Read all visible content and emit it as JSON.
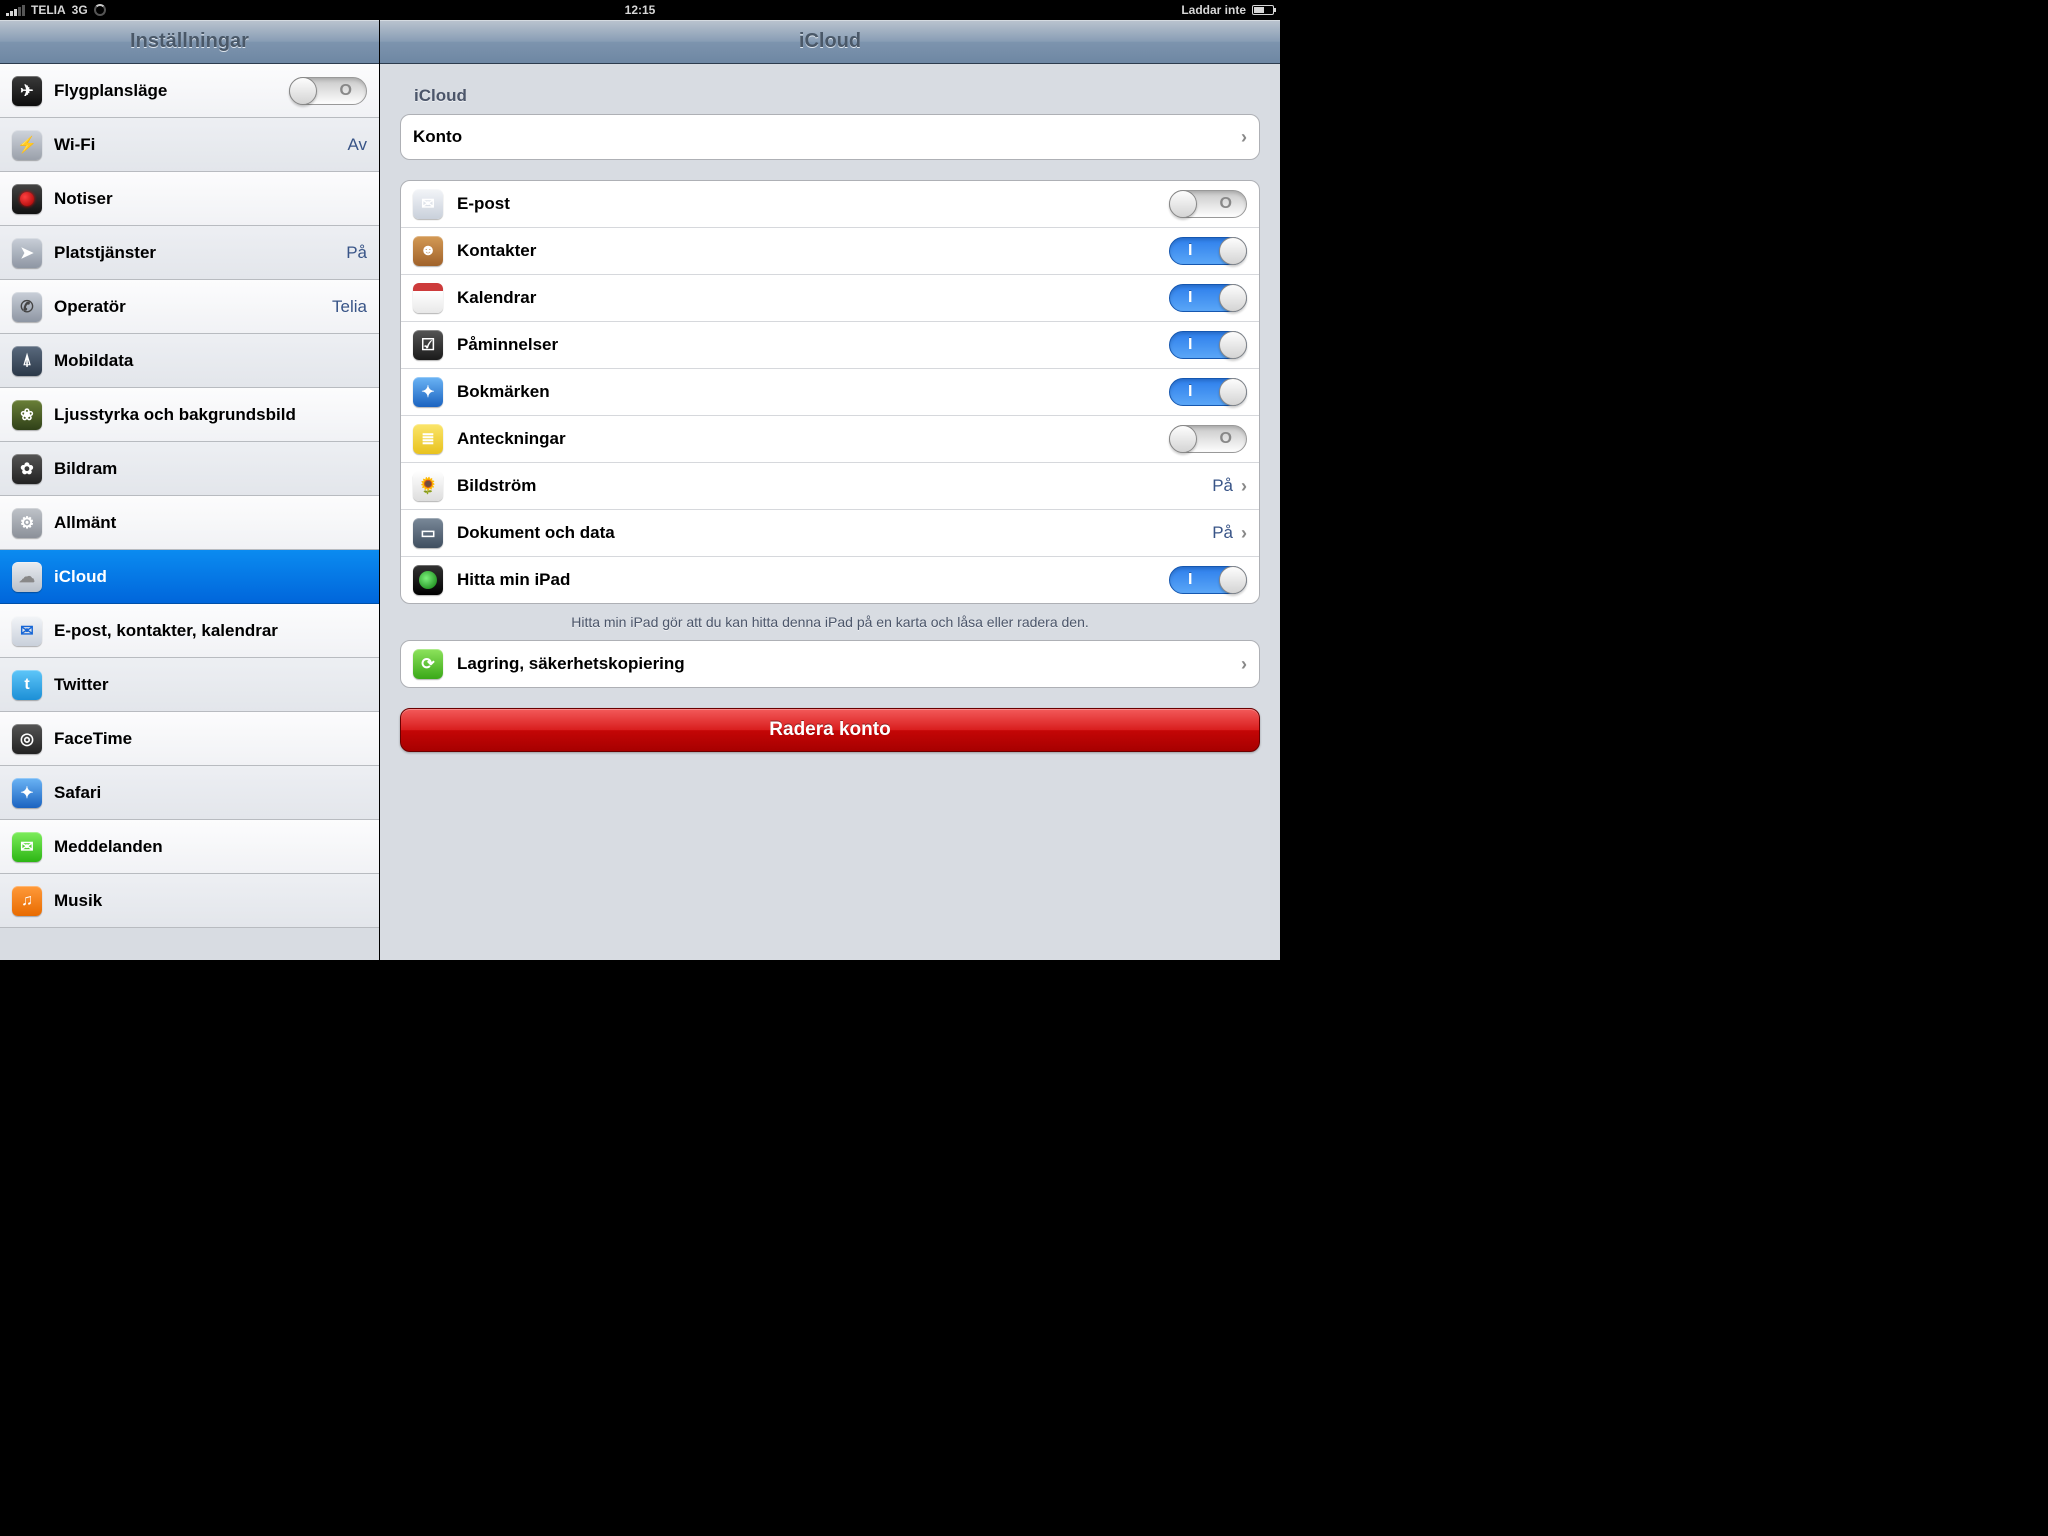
{
  "status": {
    "carrier": "TELIA",
    "network": "3G",
    "time": "12:15",
    "right": "Laddar inte"
  },
  "sidebar": {
    "title": "Inställningar",
    "items": [
      {
        "label": "Flygplansläge",
        "type": "toggle",
        "toggle": "off",
        "icon": "i-airplane",
        "glyph": "✈"
      },
      {
        "label": "Wi-Fi",
        "type": "value",
        "value": "Av",
        "icon": "i-wifi",
        "glyph": "⚡"
      },
      {
        "label": "Notiser",
        "type": "plain",
        "icon": "i-notif",
        "glyph": ""
      },
      {
        "label": "Platstjänster",
        "type": "value",
        "value": "På",
        "icon": "i-loc",
        "glyph": "➤"
      },
      {
        "label": "Operatör",
        "type": "value",
        "value": "Telia",
        "icon": "i-op",
        "glyph": "✆"
      },
      {
        "label": "Mobildata",
        "type": "plain",
        "icon": "i-cell",
        "glyph": "⍋"
      },
      {
        "label": "Ljusstyrka och bakgrundsbild",
        "type": "plain",
        "icon": "i-bright",
        "glyph": "❀"
      },
      {
        "label": "Bildram",
        "type": "plain",
        "icon": "i-frame",
        "glyph": "✿"
      },
      {
        "label": "Allmänt",
        "type": "plain",
        "icon": "i-general",
        "glyph": "⚙"
      },
      {
        "label": "iCloud",
        "type": "plain",
        "icon": "i-icloud",
        "glyph": "☁",
        "selected": true
      },
      {
        "label": "E-post, kontakter, kalendrar",
        "type": "plain",
        "icon": "i-mail",
        "glyph": "✉"
      },
      {
        "label": "Twitter",
        "type": "plain",
        "icon": "i-twitter",
        "glyph": "t"
      },
      {
        "label": "FaceTime",
        "type": "plain",
        "icon": "i-facetime",
        "glyph": "◎"
      },
      {
        "label": "Safari",
        "type": "plain",
        "icon": "i-safari",
        "glyph": "✦"
      },
      {
        "label": "Meddelanden",
        "type": "plain",
        "icon": "i-msg",
        "glyph": "✉"
      },
      {
        "label": "Musik",
        "type": "plain",
        "icon": "i-music",
        "glyph": "♫"
      }
    ]
  },
  "detail": {
    "title": "iCloud",
    "section_header": "iCloud",
    "account_row": {
      "label": "Konto",
      "value": ""
    },
    "services": [
      {
        "label": "E-post",
        "icon": "i-mail",
        "glyph": "✉",
        "type": "toggle",
        "toggle": "off"
      },
      {
        "label": "Kontakter",
        "icon": "i-contacts",
        "glyph": "☻",
        "type": "toggle",
        "toggle": "on"
      },
      {
        "label": "Kalendrar",
        "icon": "i-cal",
        "glyph": "",
        "type": "toggle",
        "toggle": "on"
      },
      {
        "label": "Påminnelser",
        "icon": "i-rem",
        "glyph": "☑",
        "type": "toggle",
        "toggle": "on"
      },
      {
        "label": "Bokmärken",
        "icon": "i-safari2",
        "glyph": "✦",
        "type": "toggle",
        "toggle": "on"
      },
      {
        "label": "Anteckningar",
        "icon": "i-notes",
        "glyph": "≣",
        "type": "toggle",
        "toggle": "off"
      },
      {
        "label": "Bildström",
        "icon": "i-photo",
        "glyph": "🌻",
        "type": "link",
        "value": "På"
      },
      {
        "label": "Dokument och data",
        "icon": "i-doc",
        "glyph": "▭",
        "type": "link",
        "value": "På"
      },
      {
        "label": "Hitta min iPad",
        "icon": "i-find",
        "glyph": "",
        "type": "toggle",
        "toggle": "on"
      }
    ],
    "find_footer": "Hitta min iPad gör att du kan hitta denna iPad på en karta och låsa eller radera den.",
    "storage_row": {
      "label": "Lagring, säkerhetskopiering",
      "icon": "i-storage",
      "glyph": "⟳"
    },
    "delete_label": "Radera konto"
  }
}
